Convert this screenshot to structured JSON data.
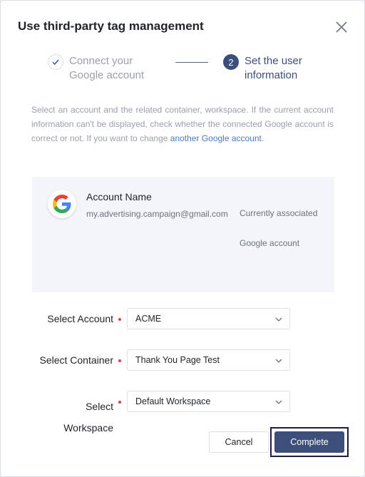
{
  "dialog": {
    "title": "Use third-party tag management",
    "close_icon": "close-icon"
  },
  "steps": [
    {
      "state": "done",
      "icon": "check-icon",
      "label": "Connect your Google account"
    },
    {
      "state": "active",
      "number": "2",
      "label": "Set the user information"
    }
  ],
  "description": {
    "text": "Select an account and the related container, workspace. If the current account information can't be displayed, check whether the connected Google account is correct or not. If you want to change ",
    "link": "another Google account",
    "end": "."
  },
  "account": {
    "logo_icon": "google-logo-icon",
    "name": "Account Name",
    "email": "my.advertising.campaign@gmail.com",
    "status": "Currently associated Google account"
  },
  "form": {
    "account": {
      "label": "Select Account",
      "value": "ACME"
    },
    "container": {
      "label": "Select Container",
      "value": "Thank You Page Test"
    },
    "workspace": {
      "label": "Select Workspace",
      "value": "Default Workspace"
    }
  },
  "buttons": {
    "cancel": "Cancel",
    "complete": "Complete"
  },
  "colors": {
    "primary": "#3c4f7b",
    "required": "#e8384f",
    "link": "#4a7bc4"
  }
}
